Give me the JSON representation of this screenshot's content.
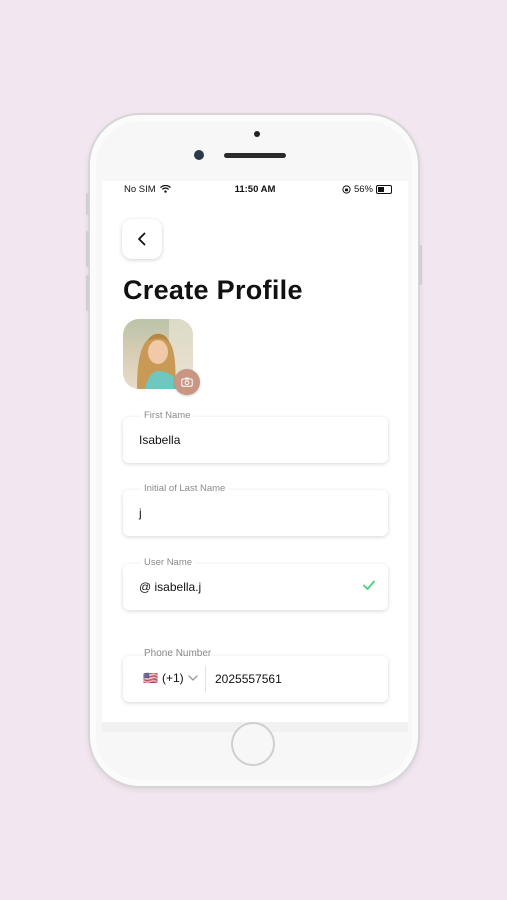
{
  "status_bar": {
    "carrier": "No SIM",
    "time": "11:50 AM",
    "battery": "56%",
    "battery_level": 0.56,
    "icons": [
      "wifi-icon",
      "orientation-lock-icon",
      "battery-icon"
    ]
  },
  "header": {
    "back_icon": "chevron-left-icon",
    "title": "Create Profile"
  },
  "profile_photo": {
    "badge_icon": "camera-icon"
  },
  "form": {
    "first_name": {
      "label": "First Name",
      "value": "Isabella"
    },
    "last_initial": {
      "label": "Initial of Last Name",
      "value": "j"
    },
    "user_name": {
      "label": "User Name",
      "value": "@ isabella.j",
      "valid_icon": "checkmark-icon"
    },
    "phone": {
      "label": "Phone Number",
      "country_flag": "🇺🇸",
      "country_code": "(+1)",
      "value": "2025557561"
    }
  },
  "colors": {
    "background": "#f2e6f0",
    "accent_badge": "#c89683",
    "check": "#4cd07d"
  }
}
